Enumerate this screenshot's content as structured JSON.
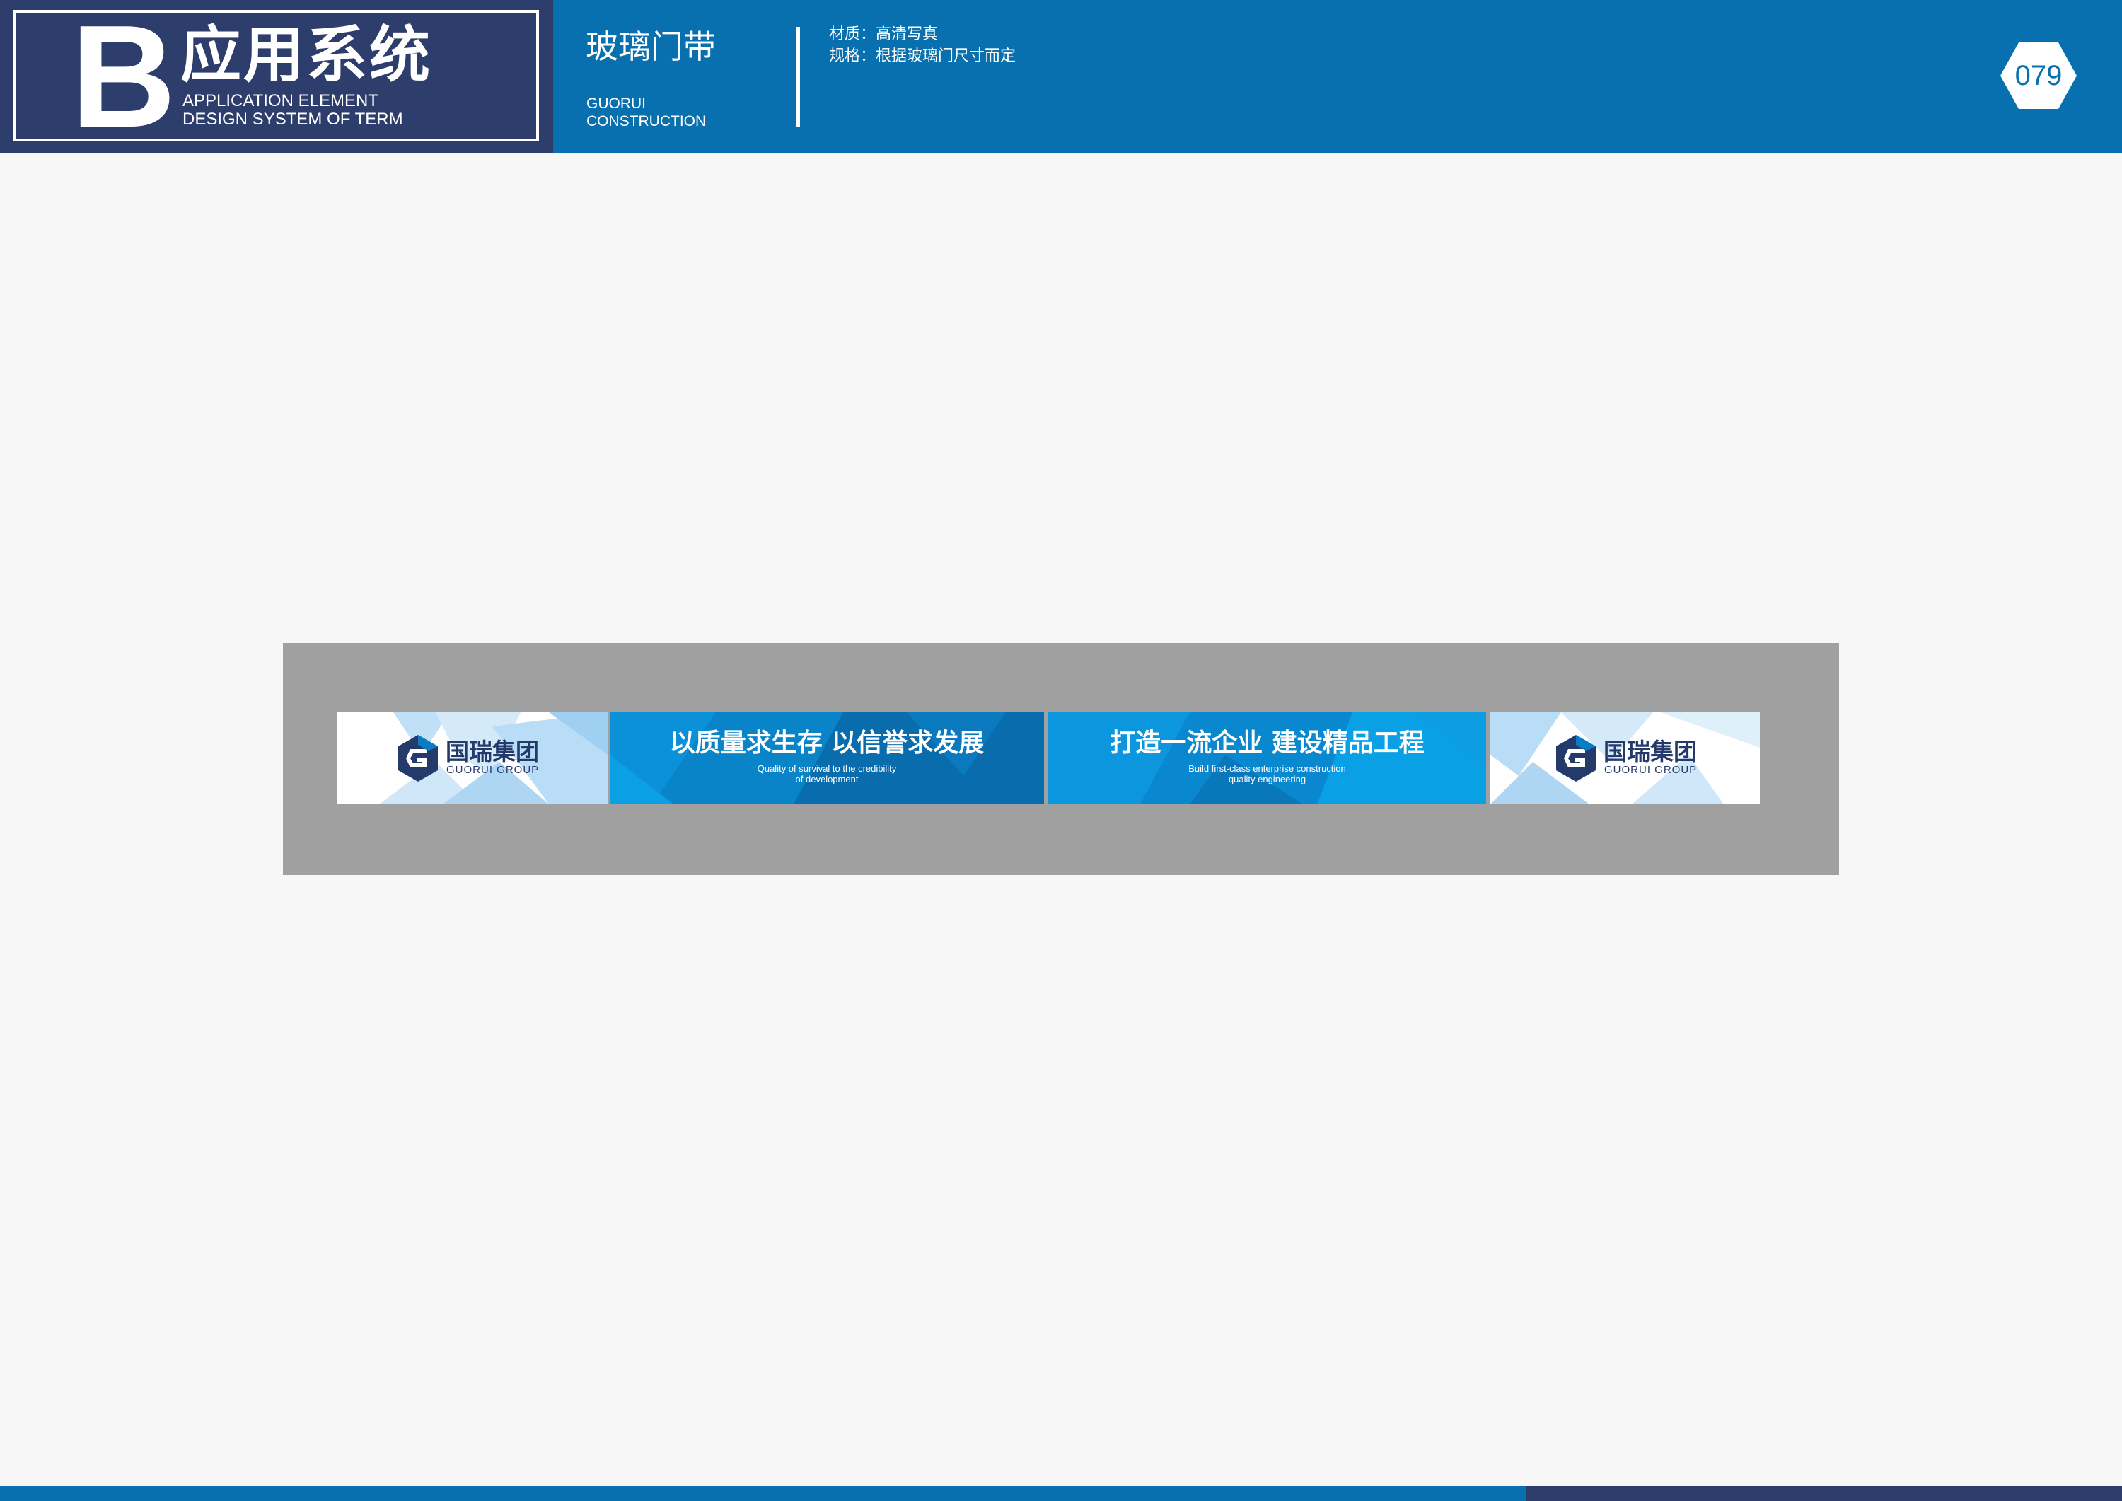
{
  "colors": {
    "header_blue": "#0870ae",
    "navy": "#2d3d6c",
    "frame_gray": "#a0a0a0",
    "banner_blue": "#0a7cc4"
  },
  "header": {
    "letter": "B",
    "title": "应用系统",
    "subtitle_line1": "APPLICATION ELEMENT",
    "subtitle_line2": "DESIGN SYSTEM OF TERM",
    "section_title": "玻璃门带",
    "section_sub_line1": "GUORUI",
    "section_sub_line2": "CONSTRUCTION",
    "material": "材质：高清写真",
    "spec": "规格：根据玻璃门尺寸而定",
    "page_number": "079"
  },
  "banner": {
    "logo_left": {
      "cn": "国瑞集团",
      "en": "GUORUI GROUP",
      "icon": "guorui-g-hexagon-icon"
    },
    "slogan_1": {
      "cn": "以质量求生存  以信誉求发展",
      "en_line1": "Quality of survival to the credibility",
      "en_line2": "of development"
    },
    "slogan_2": {
      "cn": "打造一流企业  建设精品工程",
      "en_line1": "Build first-class enterprise construction",
      "en_line2": "quality engineering"
    },
    "logo_right": {
      "cn": "国瑞集团",
      "en": "GUORUI GROUP",
      "icon": "guorui-g-hexagon-icon"
    }
  }
}
